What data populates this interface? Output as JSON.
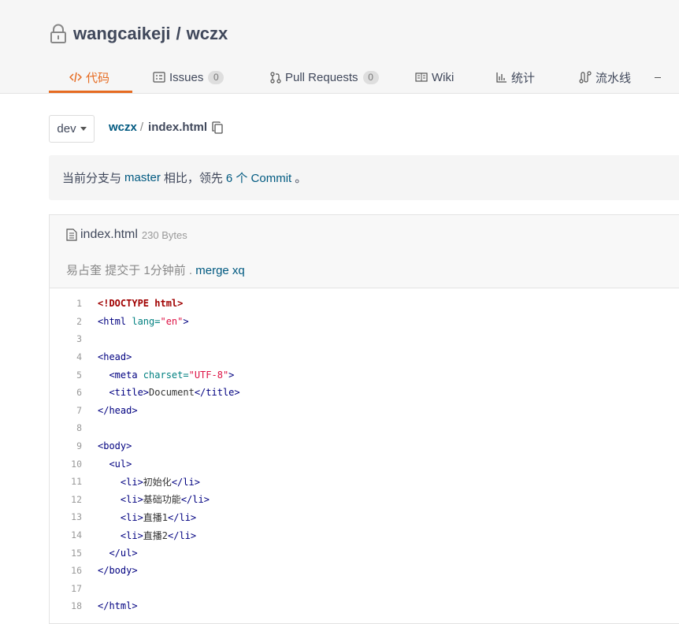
{
  "repo": {
    "owner": "wangcaikeji",
    "separator": "/",
    "name": "wczx"
  },
  "tabs": [
    {
      "label": "代码"
    },
    {
      "label": "Issues",
      "count": "0"
    },
    {
      "label": "Pull Requests",
      "count": "0"
    },
    {
      "label": "Wiki"
    },
    {
      "label": "统计"
    },
    {
      "label": "流水线"
    }
  ],
  "branch": {
    "current": "dev"
  },
  "breadcrumb": {
    "root": "wczx",
    "separator": "/",
    "file": "index.html"
  },
  "compare": {
    "prefix": "当前分支与",
    "base": "master",
    "middle": "相比，领先",
    "ahead": "6 个 Commit",
    "suffix": "。"
  },
  "file": {
    "name": "index.html",
    "size": "230 Bytes",
    "commit": {
      "author": "易占奎",
      "action": "提交于",
      "time": "1分钟前",
      "separator": ".",
      "message": "merge xq"
    }
  },
  "code": {
    "line_numbers": [
      "1",
      "2",
      "3",
      "4",
      "5",
      "6",
      "7",
      "8",
      "9",
      "10",
      "11",
      "12",
      "13",
      "14",
      "15",
      "16",
      "17",
      "18"
    ],
    "l1": "<!DOCTYPE html>",
    "l2": {
      "open": "<html ",
      "attr": "lang=",
      "val": "\"en\"",
      "close": ">"
    },
    "l4": "<head>",
    "l5": {
      "open": "  <meta ",
      "attr": "charset=",
      "val": "\"UTF-8\"",
      "close": ">"
    },
    "l6": {
      "open": "  <title>",
      "text": "Document",
      "close": "</title>"
    },
    "l7": "</head>",
    "l9": "<body>",
    "l10": "  <ul>",
    "li_items": [
      "初始化",
      "基础功能",
      "直播1",
      "直播2"
    ],
    "li_open": "    <li>",
    "li_close": "</li>",
    "l15": "  </ul>",
    "l16": "</body>",
    "l18": "</html>"
  }
}
